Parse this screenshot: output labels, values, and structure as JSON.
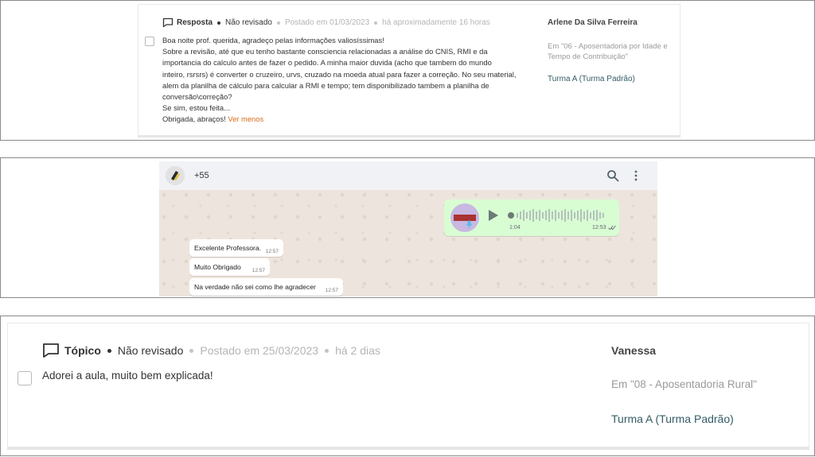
{
  "colors": {
    "accent_link": "#d96b1a",
    "group_text": "#335c66",
    "bubble_out": "#d9fdd3",
    "chat_bg": "#ede5dd"
  },
  "post1": {
    "type": "Resposta",
    "status": "Não revisado",
    "posted": "Postado em 01/03/2023",
    "relative": "há aproximadamente 16 horas",
    "body_lines": [
      "Boa noite prof. querida, agradeço pelas informações valiosíssimas!",
      "Sobre a revisão, até que eu tenho bastante consciencia relacionadas a análise do CNIS, RMI e da",
      "importancia do calculo antes de fazer o pedido. A minha maior duvida (acho que tambem do mundo",
      "inteiro, rsrsrs) é converter o cruzeiro, urvs, cruzado na moeda atual para fazer a correção. No seu material,",
      "alem da planilha de cálculo para calcular a RMI e tempo; tem disponibilizado tambem a planilha de",
      "conversão\\correção?",
      "Se sim, estou feita...",
      "Obrigada, abraços!"
    ],
    "see_less": "Ver menos",
    "author": "Arlene Da Silva Ferreira",
    "course": "Em \"06 - Aposentadoria por Idade e Tempo de Contribuição\"",
    "group": "Turma A (Turma Padrão)"
  },
  "chat": {
    "contact": "+55",
    "voice": {
      "duration": "1:04",
      "time": "12:53"
    },
    "messages": [
      {
        "text": "Excelente Professora.",
        "time": "12:57"
      },
      {
        "text": "Muito Obrigado",
        "time": "12:57"
      },
      {
        "text": "Na verdade não sei como lhe agradecer",
        "time": "12:57"
      }
    ]
  },
  "post2": {
    "type": "Tópico",
    "status": "Não revisado",
    "posted": "Postado em 25/03/2023",
    "relative": "há 2 dias",
    "body": "Adorei a aula, muito bem explicada!",
    "author": "Vanessa",
    "course": "Em \"08 - Aposentadoria Rural\"",
    "group": "Turma A (Turma Padrão)"
  }
}
